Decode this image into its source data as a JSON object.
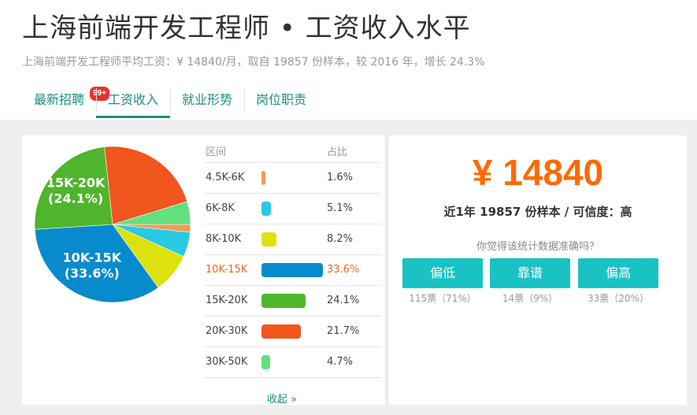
{
  "header": {
    "title": "上海前端开发工程师 • 工资收入水平",
    "subtitle": "上海前端开发工程师平均工资：¥ 14840/月，取自 19857 份样本，较 2016 年，增长 24.3%"
  },
  "tabs": [
    {
      "label": "最新招聘",
      "badge": "99+"
    },
    {
      "label": "工资收入"
    },
    {
      "label": "就业形势"
    },
    {
      "label": "岗位职责"
    }
  ],
  "table": {
    "col_range": "区间",
    "col_ratio": "占比",
    "collapse_label": "收起 »"
  },
  "chart_data": {
    "type": "pie",
    "categories": [
      "4.5K-6K",
      "6K-8K",
      "8K-10K",
      "10K-15K",
      "15K-20K",
      "20K-30K",
      "30K-50K"
    ],
    "values": [
      1.6,
      5.1,
      8.2,
      33.6,
      24.1,
      21.7,
      4.7
    ],
    "percent_labels": [
      "1.6%",
      "5.1%",
      "8.2%",
      "33.6%",
      "24.1%",
      "21.7%",
      "4.7%"
    ],
    "slice_labels": [
      "",
      "",
      "",
      "10K-15K\n(33.6%)",
      "15K-20K\n(24.1%)",
      "",
      ""
    ],
    "colors": [
      "#f29b57",
      "#29c9e2",
      "#dde10c",
      "#078bcc",
      "#4fb52c",
      "#f0561d",
      "#62e07e"
    ],
    "highlight": "10K-15K"
  },
  "summary": {
    "salary": "¥ 14840",
    "sample_text": "近1年 19857 份样本 / 可信度：高",
    "question": "你觉得该统计数据准确吗？",
    "votes": [
      {
        "label": "偏低",
        "count": "115票（71%）"
      },
      {
        "label": "靠谱",
        "count": "14票（9%）"
      },
      {
        "label": "偏高",
        "count": "33票（20%）"
      }
    ]
  },
  "colors": {
    "accent": "#1a8e7f",
    "orange": "#ff6a00",
    "button": "#19c2c4",
    "badge": "#e8322c"
  }
}
